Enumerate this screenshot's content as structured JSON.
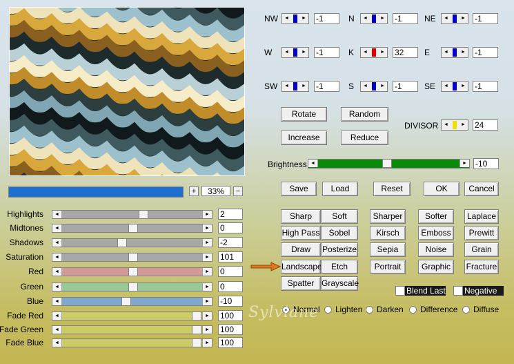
{
  "zoom": {
    "plus": "+",
    "minus": "−",
    "value": "33%"
  },
  "sliders": [
    {
      "label": "Highlights",
      "value": "2",
      "track": "#a8a8a8",
      "thumb": 0.58
    },
    {
      "label": "Midtones",
      "value": "0",
      "track": "#a8a8a8",
      "thumb": 0.5
    },
    {
      "label": "Shadows",
      "value": "-2",
      "track": "#a8a8a8",
      "thumb": 0.42
    },
    {
      "label": "Saturation",
      "value": "101",
      "track": "#a8a8a8",
      "thumb": 0.5
    },
    {
      "label": "Red",
      "value": "0",
      "track": "#d49999",
      "thumb": 0.5
    },
    {
      "label": "Green",
      "value": "0",
      "track": "#99c899",
      "thumb": 0.5
    },
    {
      "label": "Blue",
      "value": "-10",
      "track": "#80a8cc",
      "thumb": 0.45
    },
    {
      "label": "Fade Red",
      "value": "100",
      "track": "#cccc66",
      "thumb": 0.98
    },
    {
      "label": "Fade Green",
      "value": "100",
      "track": "#cccc66",
      "thumb": 0.98
    },
    {
      "label": "Fade Blue",
      "value": "100",
      "track": "#cccc66",
      "thumb": 0.98
    }
  ],
  "compass": [
    {
      "label": "NW",
      "value": "-1",
      "knob": "#0000cc"
    },
    {
      "label": "N",
      "value": "-1",
      "knob": "#0000cc"
    },
    {
      "label": "NE",
      "value": "-1",
      "knob": "#0000cc"
    },
    {
      "label": "W",
      "value": "-1",
      "knob": "#0000cc"
    },
    {
      "label": "K",
      "value": "32",
      "knob": "#e00000"
    },
    {
      "label": "E",
      "value": "-1",
      "knob": "#0000cc"
    },
    {
      "label": "SW",
      "value": "-1",
      "knob": "#0000cc"
    },
    {
      "label": "S",
      "value": "-1",
      "knob": "#0000cc"
    },
    {
      "label": "SE",
      "value": "-1",
      "knob": "#0000cc"
    }
  ],
  "actions": {
    "rotate": "Rotate",
    "random": "Random",
    "increase": "Increase",
    "reduce": "Reduce"
  },
  "divisor": {
    "label": "DIVISOR",
    "value": "24",
    "knob": "#f0e000"
  },
  "brightness": {
    "label": "Brightness",
    "value": "-10",
    "level": 0.48
  },
  "dialog": {
    "save": "Save",
    "load": "Load",
    "reset": "Reset",
    "ok": "OK",
    "cancel": "Cancel"
  },
  "presets": [
    [
      "Sharp",
      "Soft",
      "Sharper",
      "Softer",
      "Laplace"
    ],
    [
      "High Pass",
      "Sobel",
      "Kirsch",
      "Emboss",
      "Prewitt"
    ],
    [
      "Draw",
      "Posterize",
      "Sepia",
      "Noise",
      "Grain"
    ],
    [
      "Landscape",
      "Etch",
      "Portrait",
      "Graphic",
      "Fracture"
    ],
    [
      "Spatter",
      "Grayscale"
    ]
  ],
  "options": {
    "blend_last": "Blend Last",
    "negative": "Negative"
  },
  "modes": [
    {
      "label": "Normal",
      "selected": true
    },
    {
      "label": "Lighten",
      "selected": false
    },
    {
      "label": "Darken",
      "selected": false
    },
    {
      "label": "Difference",
      "selected": false
    },
    {
      "label": "Diffuse",
      "selected": false
    }
  ],
  "watermark": "Sylviane",
  "arrow_color": "#e07820",
  "icons": {
    "arrow": "arrow-right-icon",
    "left": "◄",
    "right": "►"
  }
}
